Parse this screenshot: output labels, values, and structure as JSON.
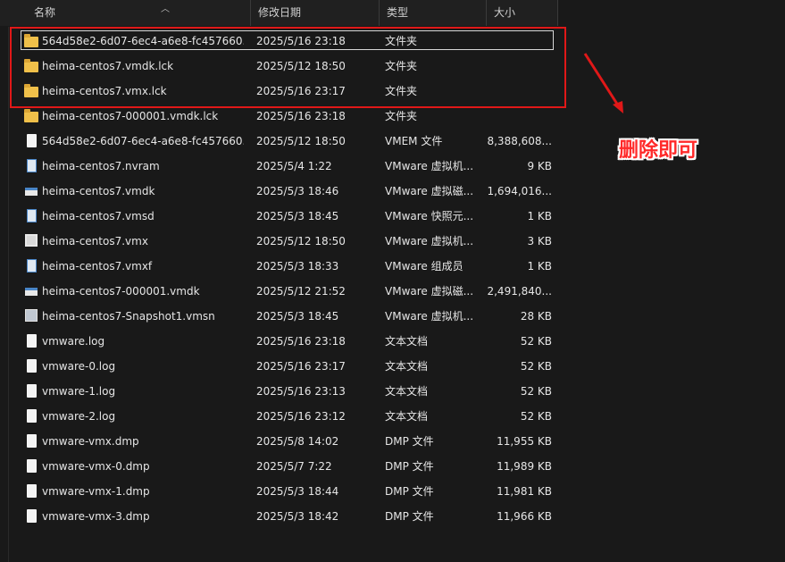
{
  "header": {
    "name": "名称",
    "date": "修改日期",
    "type": "类型",
    "size": "大小"
  },
  "rows": [
    {
      "icon": "folder-icon",
      "name": "564d58e2-6d07-6ec4-a6e8-fc457660...",
      "date": "2025/5/16 23:18",
      "type": "文件夹",
      "size": ""
    },
    {
      "icon": "folder-icon",
      "name": "heima-centos7.vmdk.lck",
      "date": "2025/5/12 18:50",
      "type": "文件夹",
      "size": ""
    },
    {
      "icon": "folder-icon",
      "name": "heima-centos7.vmx.lck",
      "date": "2025/5/16 23:17",
      "type": "文件夹",
      "size": ""
    },
    {
      "icon": "folder-icon",
      "name": "heima-centos7-000001.vmdk.lck",
      "date": "2025/5/16 23:18",
      "type": "文件夹",
      "size": ""
    },
    {
      "icon": "file-icon",
      "name": "564d58e2-6d07-6ec4-a6e8-fc457660...",
      "date": "2025/5/12 18:50",
      "type": "VMEM 文件",
      "size": "8,388,608..."
    },
    {
      "icon": "vmware-doc-icon",
      "name": "heima-centos7.nvram",
      "date": "2025/5/4 1:22",
      "type": "VMware 虚拟机...",
      "size": "9 KB"
    },
    {
      "icon": "vmware-disk-icon",
      "name": "heima-centos7.vmdk",
      "date": "2025/5/3 18:46",
      "type": "VMware 虚拟磁...",
      "size": "1,694,016..."
    },
    {
      "icon": "vmware-doc-icon",
      "name": "heima-centos7.vmsd",
      "date": "2025/5/3 18:45",
      "type": "VMware 快照元...",
      "size": "1 KB"
    },
    {
      "icon": "vmware-vm-icon",
      "name": "heima-centos7.vmx",
      "date": "2025/5/12 18:50",
      "type": "VMware 虚拟机...",
      "size": "3 KB"
    },
    {
      "icon": "vmware-doc-icon",
      "name": "heima-centos7.vmxf",
      "date": "2025/5/3 18:33",
      "type": "VMware 组成员",
      "size": "1 KB"
    },
    {
      "icon": "vmware-disk-icon",
      "name": "heima-centos7-000001.vmdk",
      "date": "2025/5/12 21:52",
      "type": "VMware 虚拟磁...",
      "size": "2,491,840..."
    },
    {
      "icon": "vmware-snapshot-icon",
      "name": "heima-centos7-Snapshot1.vmsn",
      "date": "2025/5/3 18:45",
      "type": "VMware 虚拟机...",
      "size": "28 KB"
    },
    {
      "icon": "text-file-icon",
      "name": "vmware.log",
      "date": "2025/5/16 23:18",
      "type": "文本文档",
      "size": "52 KB"
    },
    {
      "icon": "text-file-icon",
      "name": "vmware-0.log",
      "date": "2025/5/16 23:17",
      "type": "文本文档",
      "size": "52 KB"
    },
    {
      "icon": "text-file-icon",
      "name": "vmware-1.log",
      "date": "2025/5/16 23:13",
      "type": "文本文档",
      "size": "52 KB"
    },
    {
      "icon": "text-file-icon",
      "name": "vmware-2.log",
      "date": "2025/5/16 23:12",
      "type": "文本文档",
      "size": "52 KB"
    },
    {
      "icon": "file-icon",
      "name": "vmware-vmx.dmp",
      "date": "2025/5/8 14:02",
      "type": "DMP 文件",
      "size": "11,955 KB"
    },
    {
      "icon": "file-icon",
      "name": "vmware-vmx-0.dmp",
      "date": "2025/5/7 7:22",
      "type": "DMP 文件",
      "size": "11,989 KB"
    },
    {
      "icon": "file-icon",
      "name": "vmware-vmx-1.dmp",
      "date": "2025/5/3 18:44",
      "type": "DMP 文件",
      "size": "11,981 KB"
    },
    {
      "icon": "file-icon",
      "name": "vmware-vmx-3.dmp",
      "date": "2025/5/3 18:42",
      "type": "DMP 文件",
      "size": "11,966 KB"
    }
  ],
  "annotation": {
    "text": "删除即可",
    "color": "#ff2a2a"
  },
  "colors": {
    "background": "#191919",
    "header_bg": "#202020",
    "folder": "#f0c04a",
    "highlight_box": "#e01818"
  }
}
